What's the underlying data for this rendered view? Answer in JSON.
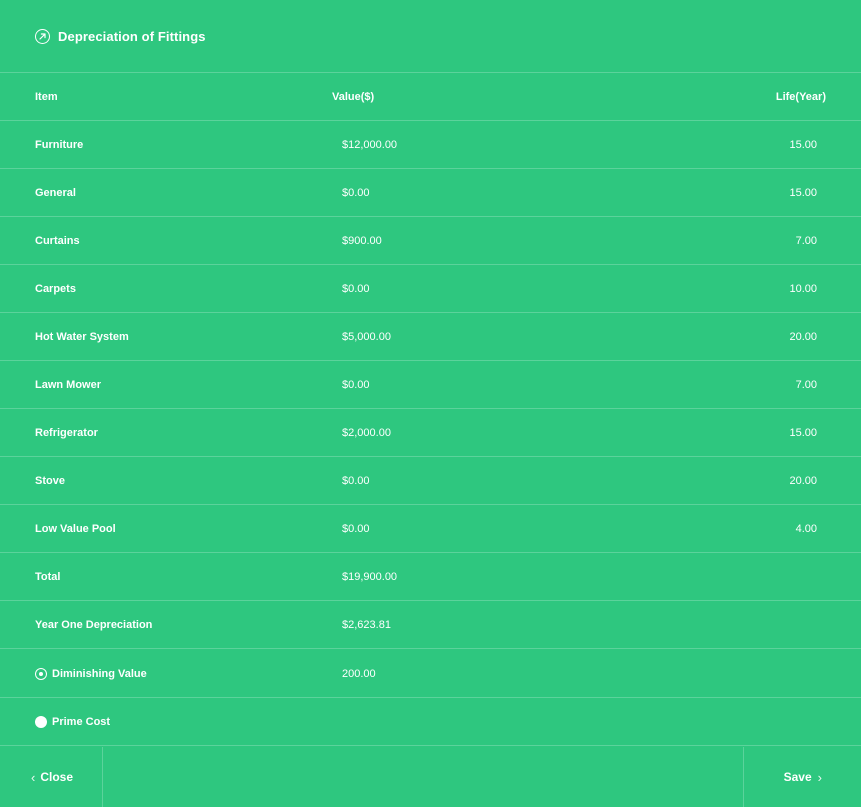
{
  "header": {
    "title": "Depreciation of Fittings",
    "icon": "arrow-up-right-circle-icon"
  },
  "table": {
    "columns": [
      "Item",
      "Value($)",
      "Life(Year)"
    ],
    "rows": [
      {
        "item": "Furniture",
        "value": "$12,000.00",
        "life": "15.00"
      },
      {
        "item": "General",
        "value": "$0.00",
        "life": "15.00"
      },
      {
        "item": "Curtains",
        "value": "$900.00",
        "life": "7.00"
      },
      {
        "item": "Carpets",
        "value": "$0.00",
        "life": "10.00"
      },
      {
        "item": "Hot Water System",
        "value": "$5,000.00",
        "life": "20.00"
      },
      {
        "item": "Lawn Mower",
        "value": "$0.00",
        "life": "7.00"
      },
      {
        "item": "Refrigerator",
        "value": "$2,000.00",
        "life": "15.00"
      },
      {
        "item": "Stove",
        "value": "$0.00",
        "life": "20.00"
      },
      {
        "item": "Low Value Pool",
        "value": "$0.00",
        "life": "4.00"
      }
    ],
    "total": {
      "label": "Total",
      "value": "$19,900.00"
    },
    "year_one": {
      "label": "Year One Depreciation",
      "value": "$2,623.81"
    }
  },
  "method": {
    "diminishing": {
      "label": "Diminishing Value",
      "value": "200.00",
      "selected": true
    },
    "prime": {
      "label": "Prime Cost",
      "selected": false
    }
  },
  "footer": {
    "close_label": "Close",
    "save_label": "Save"
  },
  "colors": {
    "background": "#2ec77f",
    "text": "#ffffff"
  }
}
